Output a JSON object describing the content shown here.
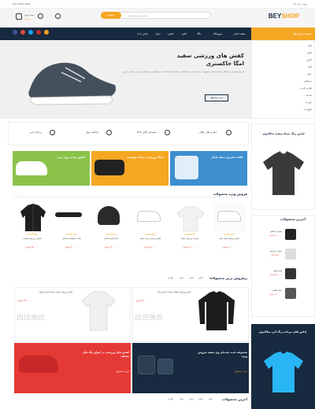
{
  "topbar": {
    "phone": "021-4567-8901",
    "login_label": "ورود / ثبت نام",
    "wishlist_label": "علاقه مندی"
  },
  "header": {
    "logo_main": "BEY",
    "logo_accent": "SHOP",
    "search_placeholder": "جستجوی محصولات...",
    "search_button": "جستجو",
    "cart_label": "سبد خرید",
    "cart_total": "۰ تومان",
    "account_label": "حساب کاربری"
  },
  "nav": {
    "categories_button": "دسته بندی ها",
    "items": [
      "صفحه اصلی",
      "فروشگاه",
      "بلاگ",
      "لباس",
      "کفش",
      "حراج",
      "تماس با ما"
    ]
  },
  "sidebar_categories": [
    "کیف",
    "لباس",
    "کفش",
    "کلاه",
    "عینک",
    "دستکش",
    "لوازم جانبی",
    "ساعت",
    "جوراب",
    "تجهیزات"
  ],
  "hero": {
    "title_line1": "کفش های ورزشی سفید",
    "title_line2": "امگا خاکستری",
    "description": "لورم ایپسوم متن ساختگی با تولید سادگی نامفهوم از صنعت چاپ و با استفاده از طراحان گرافیک است چاپگرها و متون بلکه روزنامه و مجله در ستون",
    "button": "خرید محصول"
  },
  "features": [
    {
      "title": "حمل و نقل رایگان",
      "subtitle": "برای سفارش های بالای ۲۰۰ هزار"
    },
    {
      "title": "پشتیبانی آنلاین ۲۴/۷",
      "subtitle": "پشتیبانی در تمام ساعات"
    },
    {
      "title": "بازگشت پول",
      "subtitle": "ضمانت بازگشت وجه"
    },
    {
      "title": "پرداخت امن",
      "subtitle": "پرداخت امن و مطمئن"
    }
  ],
  "promo_banners": [
    {
      "title": "کلاه سایبری سیاه بایکر",
      "subtitle": "مدل کلاه",
      "color": "#3d8fcf"
    },
    {
      "title": "ساک ورزشی سیاه دوشیده",
      "subtitle": "مدل ۲۰۲۱",
      "color": "#f5a623"
    },
    {
      "title": "کفش پیاده روی سبز",
      "subtitle": "مدل ۲۰۲۱",
      "color": "#8bc34a"
    }
  ],
  "sale_box": {
    "title": "لباس زنگ سیاه سفید سالامون",
    "price": "۲۵۰،۰۰۰ تومان"
  },
  "featured_products": {
    "title": "فروش ویژه محصولات",
    "items": [
      {
        "name": "کفش ورزشی سفید نایک",
        "price": "۸۰۰،۰۰۰ تومان"
      },
      {
        "name": "تیشرت ورزشی سفید",
        "price": "۱۸۰،۰۰۰ تومان"
      },
      {
        "name": "کفش ورزشی دونده سفید",
        "price": "۶۵۰،۰۰۰ تومان"
      },
      {
        "name": "کلاه ایمنی اسکی",
        "price": "۴۲۰،۰۰۰ تومان"
      },
      {
        "name": "ساعت هوشمند مشکی",
        "price": "۹۰۰،۰۰۰ تومان"
      },
      {
        "name": "کاپشن ورزشی مشکی",
        "price": "۷۵۰،۰۰۰ تومان"
      }
    ]
  },
  "newest_products": {
    "title": "آخرین محصولات",
    "items": [
      {
        "name": "تیشرت مشکی",
        "price": "۱۲۰،۰۰۰ تومان"
      },
      {
        "name": "جوراب ورزشی",
        "price": "۴۵،۰۰۰ تومان"
      },
      {
        "name": "کوله پشتی",
        "price": "۳۵۰،۰۰۰ تومان"
      },
      {
        "name": "عینک آفتابی",
        "price": "۲۲۰،۰۰۰ تومان"
      }
    ]
  },
  "bestsellers": {
    "title": "پرفروش ترین محصولات",
    "tabs": [
      "کیف",
      "کفش",
      "لباس",
      "عینک",
      "لوازم"
    ],
    "items": [
      {
        "name": "لباس ورزشی مشکی مردانه آستین بلند",
        "price": "۴۹۰،۰۰۰ تومان"
      },
      {
        "name": "لباس ورزشی سفید مردانه آستین کوتاه",
        "price": "۳۹۰،۰۰۰ تومان"
      }
    ],
    "countdown": [
      "۱۲",
      "۰۵",
      "۴۵",
      "۲۱"
    ]
  },
  "bottom_banners": [
    {
      "title": "مجموعه جدید چیدمان وی سفید فروش ویژه",
      "button": "خرید محصول",
      "color": "#172a3f"
    },
    {
      "title": "کفش های ورزشی در انواع رنگ های مختلف",
      "button": "خرید محصول",
      "color": "#e53935"
    }
  ],
  "dark_box": {
    "title": "لباس های مردانه زنگ آبی سالامون",
    "subtitle": "فروش ویژه"
  },
  "bottom_tabs": {
    "title": "آخرین محصولات",
    "tabs": [
      "کیف",
      "کفش",
      "لباس",
      "عینک",
      "لوازم"
    ]
  }
}
